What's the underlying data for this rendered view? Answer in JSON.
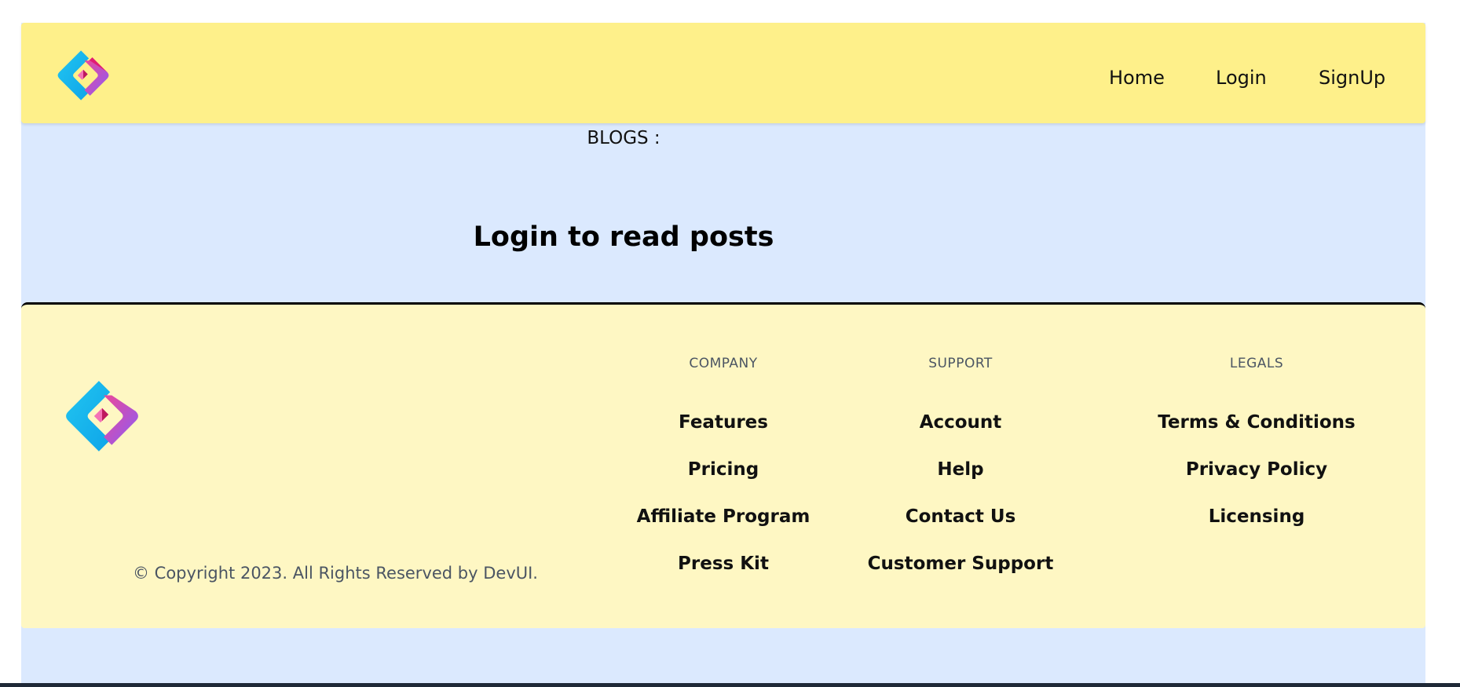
{
  "header": {
    "logo_icon": "devui-logo-icon",
    "nav": [
      {
        "label": "Home"
      },
      {
        "label": "Login"
      },
      {
        "label": "SignUp"
      }
    ],
    "background": "#fef08a"
  },
  "main": {
    "section_label": "BLOGS :",
    "message": "Login to read posts",
    "background": "#dbe9fe"
  },
  "footer": {
    "logo_icon": "devui-logo-icon",
    "copyright": "© Copyright 2023. All Rights Reserved by DevUI.",
    "columns": [
      {
        "heading": "COMPANY",
        "links": [
          "Features",
          "Pricing",
          "Affiliate Program",
          "Press Kit"
        ]
      },
      {
        "heading": "SUPPORT",
        "links": [
          "Account",
          "Help",
          "Contact Us",
          "Customer Support"
        ]
      },
      {
        "heading": "LEGALS",
        "links": [
          "Terms & Conditions",
          "Privacy Policy",
          "Licensing"
        ]
      }
    ],
    "background": "#fef7c3"
  }
}
